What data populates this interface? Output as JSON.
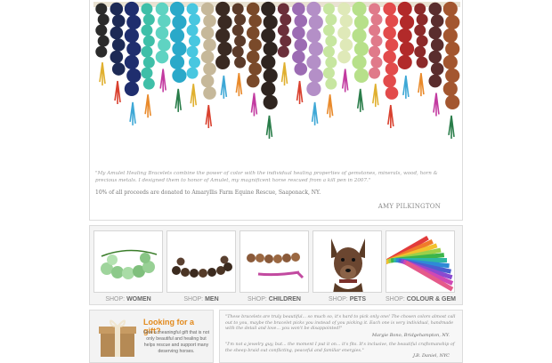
{
  "hero": {
    "quote": "\"My Amulet Healing Bracelets combine the power of color with the individual healing properties of gemstones, minerals, wood, horn & precious metals. I designed them to honor of Amulet, my magnificent horse rescued from a kill pen in 2007.\"",
    "proceeds": "10% of all proceeds are donated to Amaryllis Farm Equine Rescue, Saaponack, NY.",
    "signature": "AMY PILKINGTON"
  },
  "shop": {
    "prefix": "SHOP:",
    "items": [
      {
        "label": "WOMEN"
      },
      {
        "label": "MEN"
      },
      {
        "label": "CHILDREN"
      },
      {
        "label": "PETS"
      },
      {
        "label": "COLOUR & GEM"
      }
    ]
  },
  "gift": {
    "title": "Looking for a gift?",
    "text": "Give a meaningful gift that is not only beautiful and healing but helps rescue and support many deserving horses."
  },
  "testimonials": [
    {
      "quote": "\"These bracelets are truly beautiful... so much so, it's hard to pick only one! The chosen colors almost call out to you, maybe the bracelet picks you instead of you picking it. Each one is very individual, handmade with the detail and love... you won't be disappointed!\"",
      "author": "Margie Bono, Bridgehampton, NY."
    },
    {
      "quote": "\"I'm not a jewelry guy, but... the moment I put it on... it's fits. It's inclusive, the beautiful craftsmanship of the sheep braid out conflicting, peaceful and familiar energies.\"",
      "author": "J.B. Daniel, NYC"
    }
  ],
  "colors": {
    "accent": "#e28a1d"
  }
}
